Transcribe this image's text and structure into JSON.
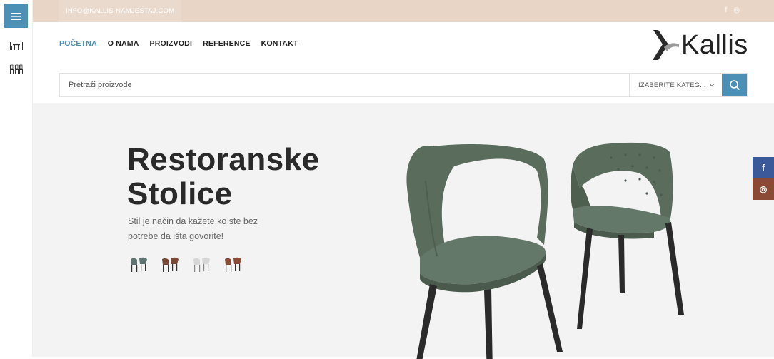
{
  "topbar": {
    "email": "INFO@KALLIS-NAMJESTAJ.COM",
    "social": [
      "f",
      "◎"
    ]
  },
  "nav": {
    "items": [
      "POČETNA",
      "O NAMA",
      "PROIZVODI",
      "REFERENCE",
      "KONTAKT"
    ]
  },
  "logo": {
    "text": "Kallis"
  },
  "search": {
    "placeholder": "Pretraži proizvode",
    "category": "IZABERITE KATEG..."
  },
  "hero": {
    "title": "Restoranske Stolice",
    "subtitle": "Stil je način da kažete ko ste bez potrebe da išta govorite!",
    "variant_colors": [
      "#5e7470",
      "#7a4a36",
      "#d6d6d6",
      "#8a4a36"
    ]
  },
  "float_social": [
    "f",
    "◎"
  ],
  "colors": {
    "accent": "#4d90b6",
    "topbar": "#e8d5c6",
    "chair": "#5b6e5e"
  }
}
